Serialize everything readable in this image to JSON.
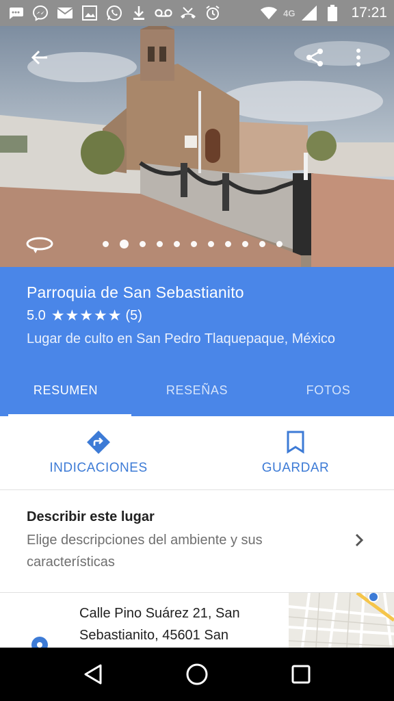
{
  "status_bar": {
    "time": "17:21",
    "network": "4G",
    "icons": [
      "message-icon",
      "messenger-icon",
      "email-icon",
      "image-icon",
      "whatsapp-icon",
      "download-icon",
      "voicemail-icon",
      "missed-call-icon",
      "alarm-icon",
      "wifi-icon",
      "signal-icon",
      "battery-icon"
    ]
  },
  "hero": {
    "photo_count": 11,
    "active_photo_index": 1
  },
  "place": {
    "name": "Parroquia de San Sebastianito",
    "rating": "5.0",
    "stars": 5,
    "review_count": "(5)",
    "category": "Lugar de culto en San Pedro Tlaquepaque, México"
  },
  "tabs": [
    {
      "label": "RESUMEN",
      "active": true
    },
    {
      "label": "RESEÑAS",
      "active": false
    },
    {
      "label": "FOTOS",
      "active": false
    }
  ],
  "actions": {
    "directions_label": "INDICACIONES",
    "save_label": "GUARDAR"
  },
  "describe": {
    "title": "Describir este lugar",
    "subtitle": "Elige descripciones del ambiente y sus características"
  },
  "address": {
    "text": "Calle Pino Suárez 21, San Sebastianito, 45601 San"
  },
  "colors": {
    "accent": "#4a86e8",
    "link": "#3d7bd6",
    "status_bar": "#8f8f8f"
  }
}
